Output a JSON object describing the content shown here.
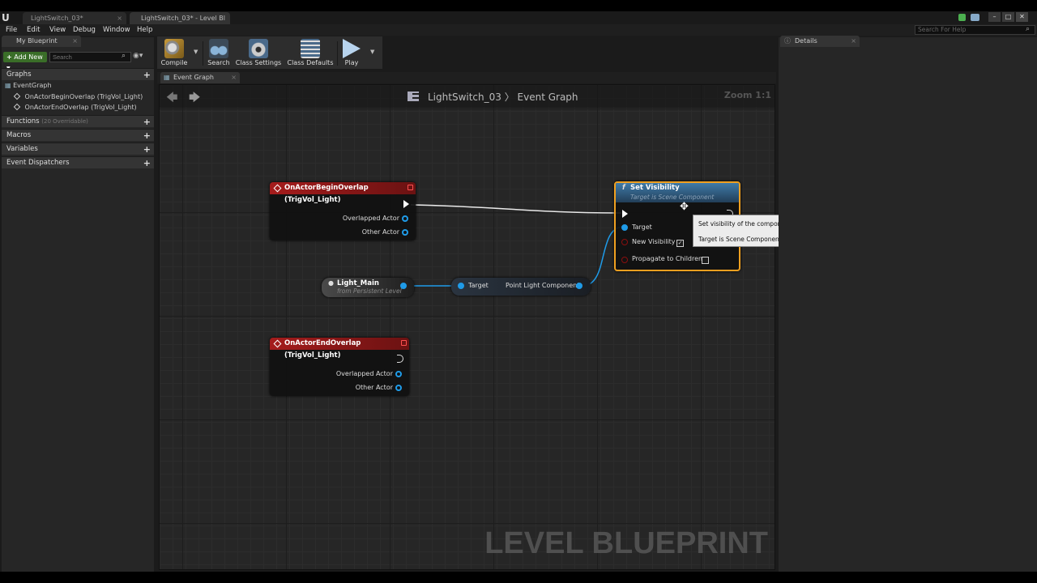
{
  "window": {
    "tabs": [
      "LightSwitch_03*",
      "LightSwitch_03* - Level Bl"
    ],
    "tab_close": "×",
    "controls": [
      "–",
      "□",
      "✕"
    ]
  },
  "menubar": {
    "items": [
      "File",
      "Edit",
      "View",
      "Debug",
      "Window",
      "Help"
    ],
    "search_placeholder": "Search For Help"
  },
  "my_blueprint": {
    "tab_label": "My Blueprint",
    "add_new_label": "Add New",
    "search_placeholder": "Search",
    "sections": {
      "graphs": "Graphs",
      "functions": "Functions",
      "functions_sub": "(20 Overridable)",
      "macros": "Macros",
      "variables": "Variables",
      "event_dispatchers": "Event Dispatchers"
    },
    "graph_items": [
      "EventGraph",
      "OnActorBeginOverlap (TrigVol_Light)",
      "OnActorEndOverlap (TrigVol_Light)"
    ]
  },
  "toolbar": {
    "compile": "Compile",
    "search": "Search",
    "class_settings": "Class Settings",
    "class_defaults": "Class Defaults",
    "play": "Play"
  },
  "graph": {
    "tab_label": "Event Graph",
    "breadcrumb": "LightSwitch_03 〉 Event Graph",
    "zoom": "Zoom 1:1",
    "watermark": "LEVEL BLUEPRINT"
  },
  "nodes": {
    "begin_overlap": {
      "title": "OnActorBeginOverlap (TrigVol_Light)",
      "pins": [
        "Overlapped Actor",
        "Other Actor"
      ]
    },
    "end_overlap": {
      "title": "OnActorEndOverlap (TrigVol_Light)",
      "pins": [
        "Overlapped Actor",
        "Other Actor"
      ]
    },
    "light_main": {
      "title": "Light_Main",
      "subtitle": "from Persistent Level"
    },
    "getter": {
      "input": "Target",
      "output": "Point Light Component"
    },
    "set_visibility": {
      "title": "Set Visibility",
      "subtitle": "Target is Scene Component",
      "icon": "f",
      "pins": [
        "Target",
        "New Visibility",
        "Propagate to Children"
      ],
      "new_visibility_checked": true,
      "propagate_checked": false
    }
  },
  "tooltip": {
    "line1": "Set visibility of the component, if during game use this to turn on/off",
    "line2": "Target is Scene Component"
  },
  "details": {
    "tab_label": "Details"
  },
  "colors": {
    "event_header": "#8b1a1a",
    "function_header": "#3a6d99",
    "object_pin": "#1f9be8",
    "selected_outline": "#f0a020"
  }
}
